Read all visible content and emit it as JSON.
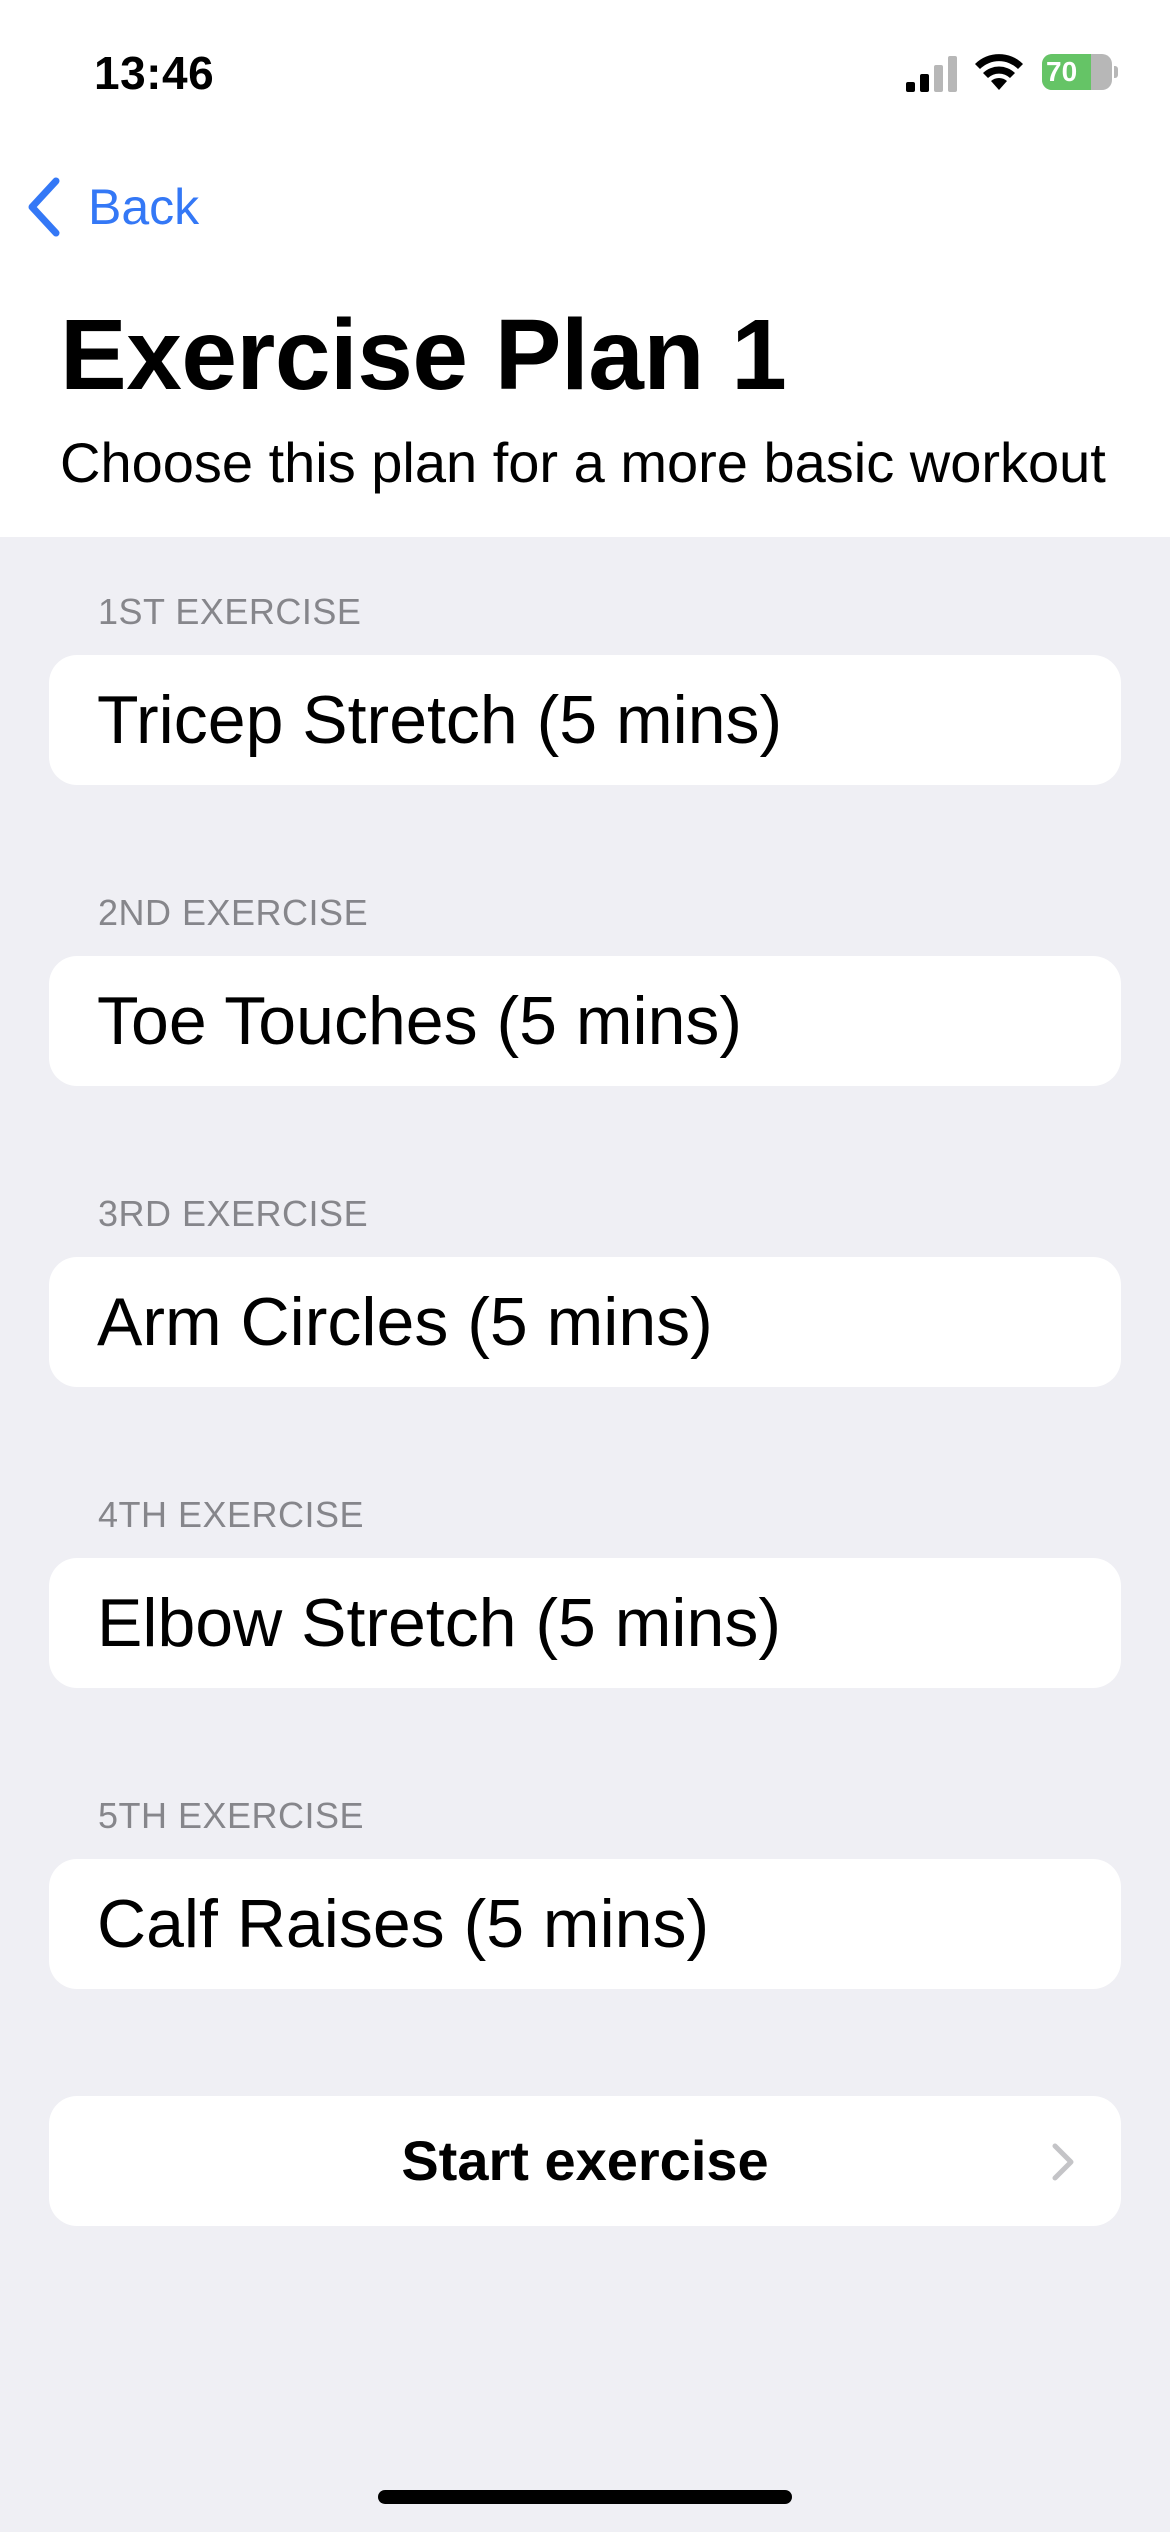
{
  "status_bar": {
    "time": "13:46",
    "battery_label": "70",
    "battery_level": 0.7,
    "battery_color": "#65c466",
    "icons": [
      "signal-icon",
      "wifi-icon",
      "battery-icon"
    ]
  },
  "nav": {
    "back_label": "Back",
    "accent_color": "#3478f6"
  },
  "header": {
    "title": "Exercise Plan 1",
    "subtitle": "Choose this plan for a more basic workout"
  },
  "exercises": [
    {
      "header": "1ST EXERCISE",
      "value": "Tricep Stretch (5 mins)"
    },
    {
      "header": "2ND EXERCISE",
      "value": "Toe Touches (5 mins)"
    },
    {
      "header": "3RD EXERCISE",
      "value": "Arm Circles (5 mins)"
    },
    {
      "header": "4TH EXERCISE",
      "value": "Elbow Stretch (5 mins)"
    },
    {
      "header": "5TH EXERCISE",
      "value": "Calf Raises (5 mins)"
    }
  ],
  "action": {
    "start_label": "Start exercise",
    "icon": "chevron-right-icon"
  }
}
